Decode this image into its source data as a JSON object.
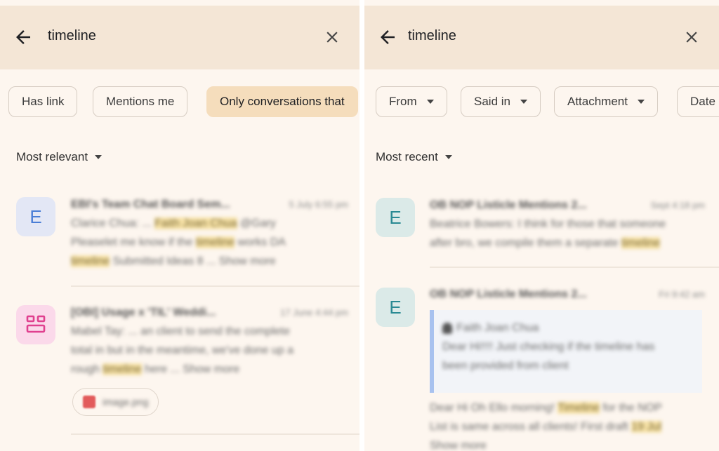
{
  "left": {
    "search_query": "timeline",
    "chips": [
      "Has link",
      "Mentions me",
      "Only conversations that"
    ],
    "sort_label": "Most relevant",
    "avatar_letter": "E",
    "results": [
      {
        "title": "EBI's Team Chat Board Sem...",
        "time": "5 July 6:55 pm",
        "lines": [
          [
            "Clarice Chua: ... ",
            "Faith Joan Chua",
            " @Gary"
          ],
          [
            "Pleaselet me know if the ",
            "timeline",
            " works ",
            "DA"
          ],
          [
            "timeline",
            " Submitted Ideas 8 ... Show more"
          ]
        ]
      },
      {
        "title": "[OBI] Usage x 'TIL' Weddi...",
        "time": "17 June 4:44 pm",
        "lines": [
          [
            "Mabel Tay: ... an client to send the complete"
          ],
          [
            "total in but in the meantime, we've done up a"
          ],
          [
            "rough ",
            "timeline",
            " here ... Show more"
          ]
        ],
        "attachment": "image.png"
      }
    ]
  },
  "right": {
    "search_query": "timeline",
    "chips": [
      "From",
      "Said in",
      "Attachment",
      "Date"
    ],
    "sort_label": "Most recent",
    "avatar_letter": "E",
    "results": [
      {
        "title": "OB NOP Listicle Mentions 2...",
        "time": "Sept 4:18 pm",
        "lines": [
          [
            "Beatrice Bowers: I think for those that someone"
          ],
          [
            "after bro, we compile them a separate ",
            "timeline"
          ]
        ]
      },
      {
        "title": "OB NOP Listicle Mentions 2...",
        "time": "Fri 9:42 am",
        "quote_author": "Faith Joan Chua",
        "quote_lines": [
          "Dear Hi!!!! Just checking if the timeline has",
          "been provided from client"
        ],
        "lines": [
          [
            "Dear Hi Oh Ello morning! ",
            "Timeline",
            " for the NOP"
          ],
          [
            "List is same across all clients! First draft ",
            "19 Jul"
          ],
          [
            "Show more"
          ]
        ]
      }
    ]
  }
}
